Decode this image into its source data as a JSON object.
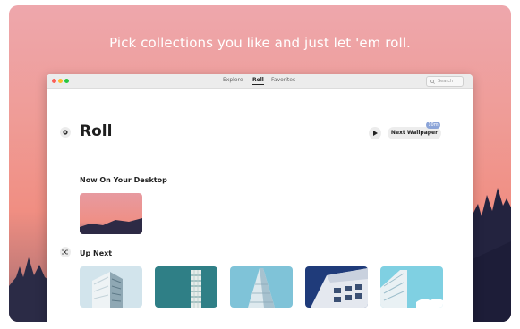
{
  "headline": "Pick collections you like and just let 'em roll.",
  "window": {
    "tabs": [
      "Explore",
      "Roll",
      "Favorites"
    ],
    "search_placeholder": "Search"
  },
  "page": {
    "title": "Roll",
    "next_button": "Next Wallpaper",
    "timer_badge": "10m"
  },
  "now_on_desktop": {
    "label": "Now On Your Desktop"
  },
  "up_next": {
    "label": "Up Next"
  },
  "colors": {
    "accent_badge": "#8ba4d8",
    "background_pink": "#ef9c97"
  },
  "icons": [
    "gear-icon",
    "play-icon",
    "shuffle-icon",
    "search-icon"
  ]
}
